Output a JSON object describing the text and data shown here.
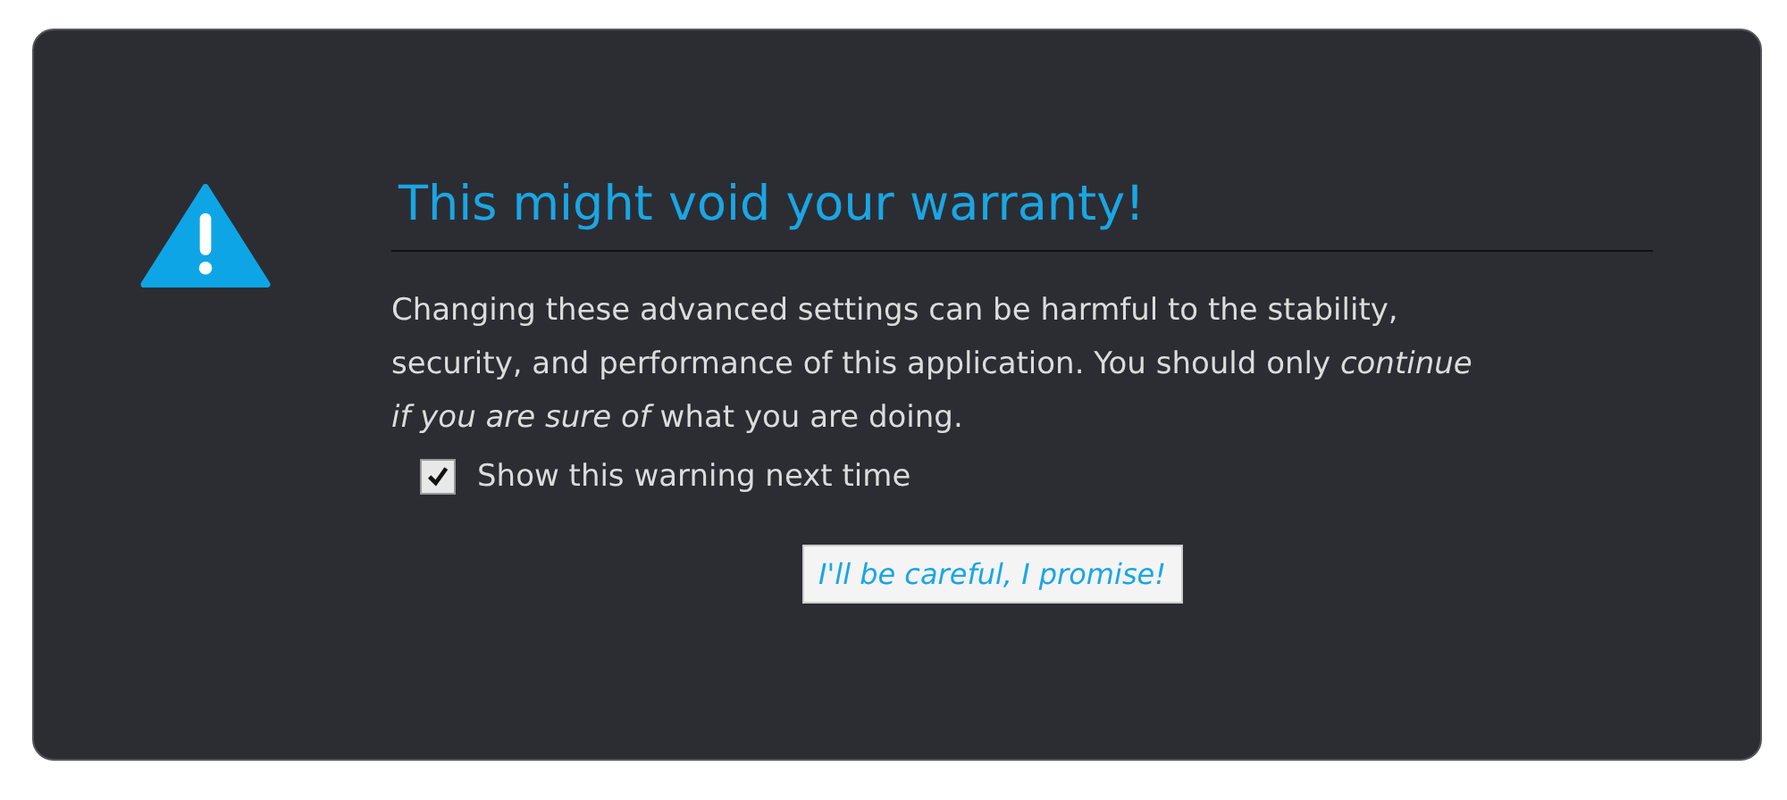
{
  "dialog": {
    "title": "This might void your warranty!",
    "message": "Changing these advanced settings can be harmful to the stability, security, and performance of this application. You should only *continue if you are sure of* what you are doing.",
    "checkbox": {
      "label": "Show this warning next time",
      "checked": true
    },
    "button": "I'll be careful, I promise!"
  }
}
